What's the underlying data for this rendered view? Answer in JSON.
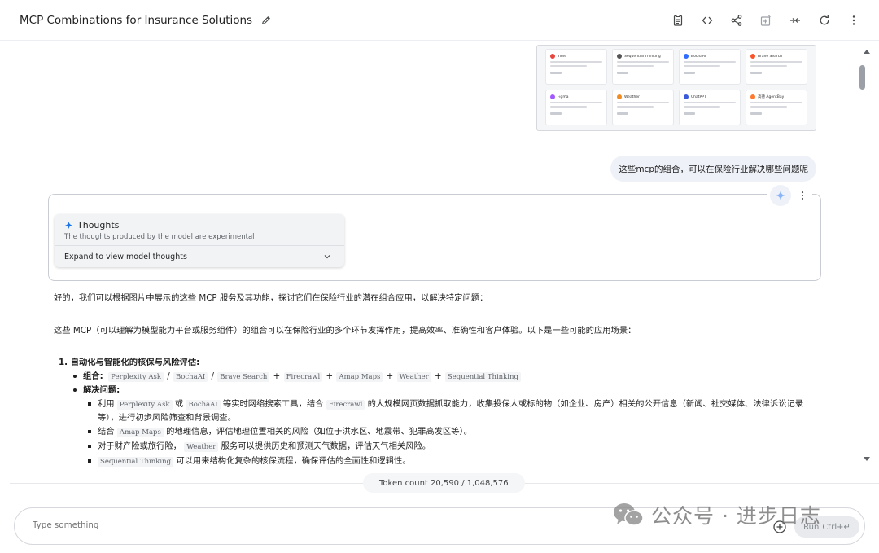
{
  "header": {
    "title": "MCP Combinations for Insurance Solutions"
  },
  "thumbnail": {
    "cards": [
      {
        "name": "Time",
        "color": "#e8453c"
      },
      {
        "name": "Sequential Thinking",
        "color": "#555555"
      },
      {
        "name": "BochaAI",
        "color": "#2f6bff"
      },
      {
        "name": "Brave Search",
        "color": "#fb542b"
      },
      {
        "name": "Figma",
        "color": "#a259ff"
      },
      {
        "name": "Weather",
        "color": "#f28b20"
      },
      {
        "name": "ChatPPT",
        "color": "#3a5bd9"
      },
      {
        "name": "高德 AgentBay",
        "color": "#ff7a2f"
      }
    ]
  },
  "user_message": "这些mcp的组合，可以在保险行业解决哪些问题呢",
  "thoughts": {
    "title": "Thoughts",
    "subtitle": "The thoughts produced by the model are experimental",
    "expand_label": "Expand to view model thoughts"
  },
  "response": {
    "p1": "好的，我们可以根据图片中展示的这些 MCP 服务及其功能，探讨它们在保险行业的潜在组合应用，以解决特定问题：",
    "p2": "这些 MCP（可以理解为模型能力平台或服务组件）的组合可以在保险行业的多个环节发挥作用，提高效率、准确性和客户体验。以下是一些可能的应用场景：",
    "section1": "1. 自动化与智能化的核保与风险评估:",
    "combo_label": "组合:",
    "combo_items": [
      "Perplexity Ask",
      "BochaAI",
      "Brave Search",
      "Firecrawl",
      "Amap Maps",
      "Weather",
      "Sequential Thinking"
    ],
    "solve_label": "解决问题:",
    "l1_a": "利用",
    "l1_code1": "Perplexity Ask",
    "l1_b": "或",
    "l1_code2": "BochaAI",
    "l1_c": "等实时网络搜索工具，结合",
    "l1_code3": "Firecrawl",
    "l1_d": "的大规模网页数据抓取能力，收集投保人或标的物（如企业、房产）相关的公开信息（新闻、社交媒体、法律诉讼记录",
    "l1_e": "等），进行初步风险筛查和背景调查。",
    "l2_a": "结合",
    "l2_code": "Amap Maps",
    "l2_b": "的地理信息，评估地理位置相关的风险（如位于洪水区、地震带、犯罪高发区等）。",
    "l3_a": "对于财产险或旅行险，",
    "l3_code": "Weather",
    "l3_b": "服务可以提供历史和预测天气数据，评估天气相关风险。",
    "l4_code": "Sequential Thinking",
    "l4_b": "可以用来结构化复杂的核保流程，确保评估的全面性和逻辑性。"
  },
  "footer": {
    "token_count": "Token count 20,590 / 1,048,576",
    "input_placeholder": "Type something",
    "run_label": "Run",
    "run_shortcut": "Ctrl+↵"
  },
  "watermark": {
    "text": "公众号 · 进步日志"
  }
}
